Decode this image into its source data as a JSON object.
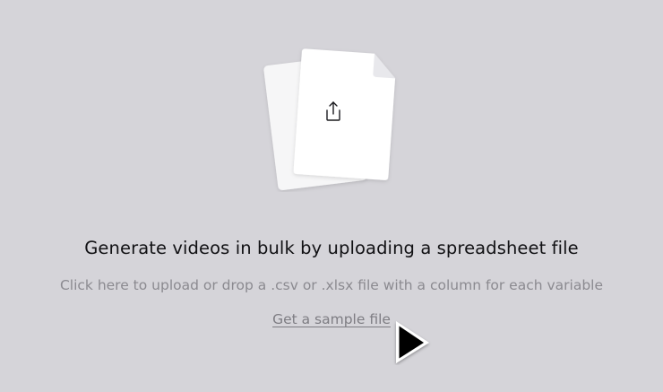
{
  "upload": {
    "icon": "upload-icon",
    "headline": "Generate videos in bulk by uploading a spreadsheet file",
    "description": "Click here to upload or drop a .csv or .xlsx file with a column for each variable",
    "sample_link": "Get a sample file"
  },
  "colors": {
    "background": "#d5d4d9",
    "headline": "#111114",
    "muted": "#8b8a90"
  }
}
